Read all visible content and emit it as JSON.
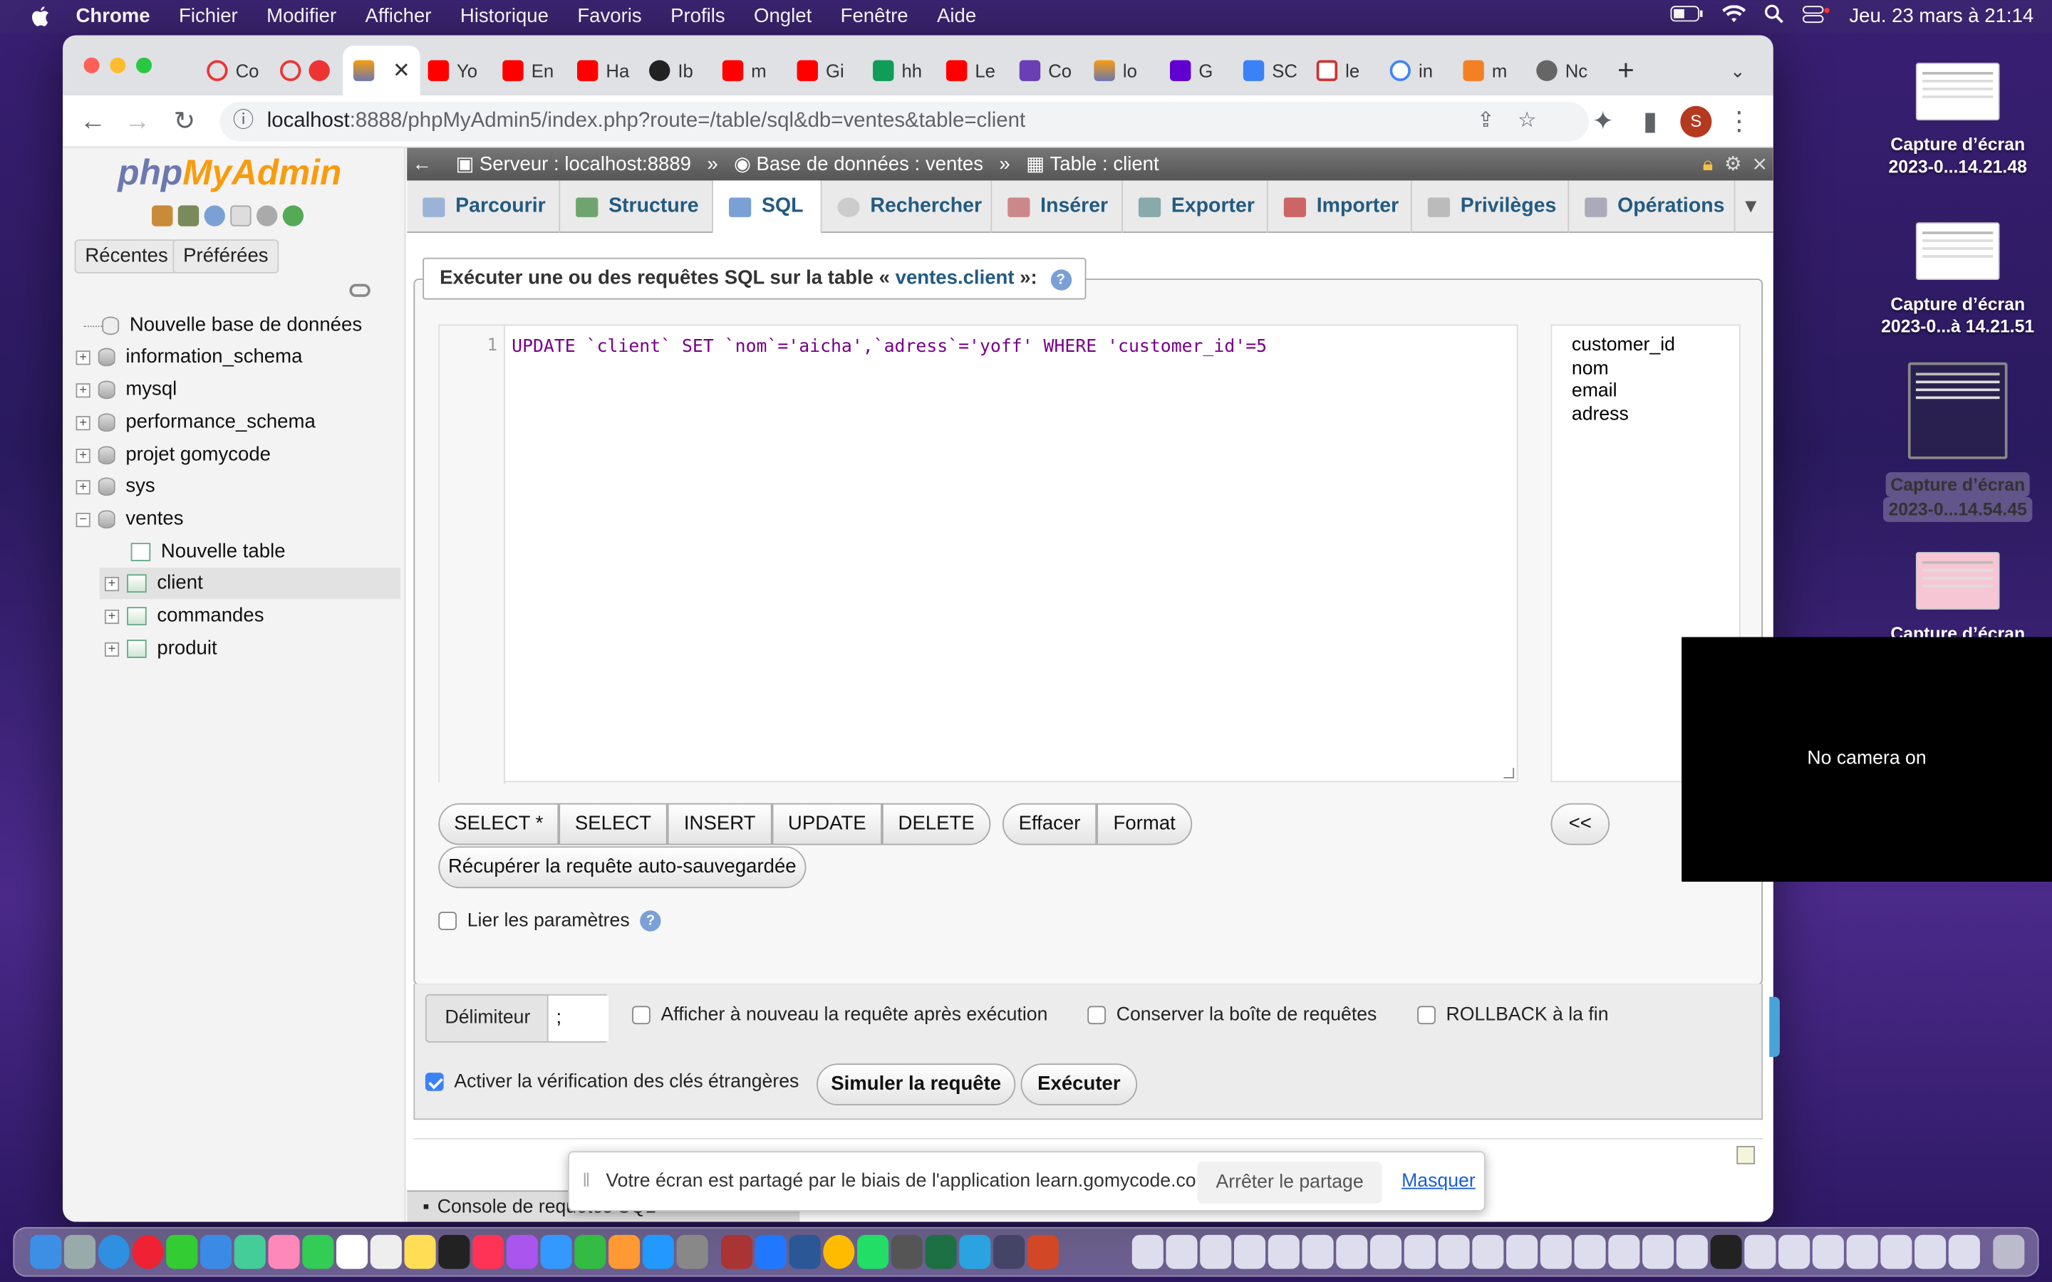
{
  "menubar": {
    "app": "Chrome",
    "items": [
      "Fichier",
      "Modifier",
      "Afficher",
      "Historique",
      "Favoris",
      "Profils",
      "Onglet",
      "Fenêtre",
      "Aide"
    ],
    "clock": "Jeu. 23 mars à  21:14"
  },
  "desktop": [
    {
      "label1": "Capture d’écran",
      "label2": "2023-0...14.21.48"
    },
    {
      "label1": "Capture d’écran",
      "label2": "2023-0...à 14.21.51"
    },
    {
      "label1": "Capture d’écran",
      "label2": "2023-0...14.54.45"
    },
    {
      "label1": "Capture d’écran",
      "label2": ""
    }
  ],
  "browser": {
    "tabs": [
      "Co",
      "",
      "",
      "Yo",
      "En",
      "Ha",
      "Ib",
      "m",
      "Gi",
      "hh",
      "Le",
      "Co",
      "lo",
      "G",
      "SC",
      "le",
      "in",
      "m",
      "Nc"
    ],
    "url_host": "localhost",
    "url_path": ":8888/phpMyAdmin5/index.php?route=/table/sql&db=ventes&table=client",
    "profile": "S"
  },
  "sidebar": {
    "logo_php": "php",
    "logo_my": "MyAdmin",
    "recent": "Récentes",
    "favorites": "Préférées",
    "new_db": "Nouvelle base de données",
    "dbs": [
      "information_schema",
      "mysql",
      "performance_schema",
      "projet gomycode",
      "sys",
      "ventes"
    ],
    "new_table": "Nouvelle table",
    "tables": [
      "client",
      "commandes",
      "produit"
    ]
  },
  "breadcrumb": {
    "server": "Serveur : localhost:8889",
    "db": "Base de données : ventes",
    "table": "Table : client"
  },
  "tabs": [
    "Parcourir",
    "Structure",
    "SQL",
    "Rechercher",
    "Insérer",
    "Exporter",
    "Importer",
    "Privilèges",
    "Opérations"
  ],
  "sql": {
    "legend_pre": "Exécuter une ou des requêtes SQL sur la table « ",
    "legend_table": "ventes.client",
    "legend_post": " »:",
    "line": "1",
    "query": "UPDATE `client` SET `nom`='aicha',`adress`='yoff' WHERE 'customer_id'=5",
    "columns": [
      "customer_id",
      "nom",
      "email",
      "adress"
    ],
    "buttons": {
      "select_star": "SELECT *",
      "select": "SELECT",
      "insert": "INSERT",
      "update": "UPDATE",
      "delete": "DELETE",
      "clear": "Effacer",
      "format": "Format",
      "insert_col": "<<",
      "restore": "Récupérer la requête auto-sauvegardée"
    },
    "bind_params": "Lier les paramètres",
    "delimiter_label": "Délimiteur",
    "delimiter_value": ";",
    "show_again": "Afficher à nouveau la requête après exécution",
    "retain_box": "Conserver la boîte de requêtes",
    "rollback": "ROLLBACK à la fin",
    "fk_check": "Activer la vérification des clés étrangères",
    "simulate": "Simuler la requête",
    "execute": "Exécuter"
  },
  "console": "Console de requêtes SQL",
  "camera": "No camera on",
  "share": {
    "text": "Votre écran est partagé par le biais de l'application learn.gomycode.co.",
    "stop": "Arrêter le partage",
    "hide": "Masquer"
  }
}
